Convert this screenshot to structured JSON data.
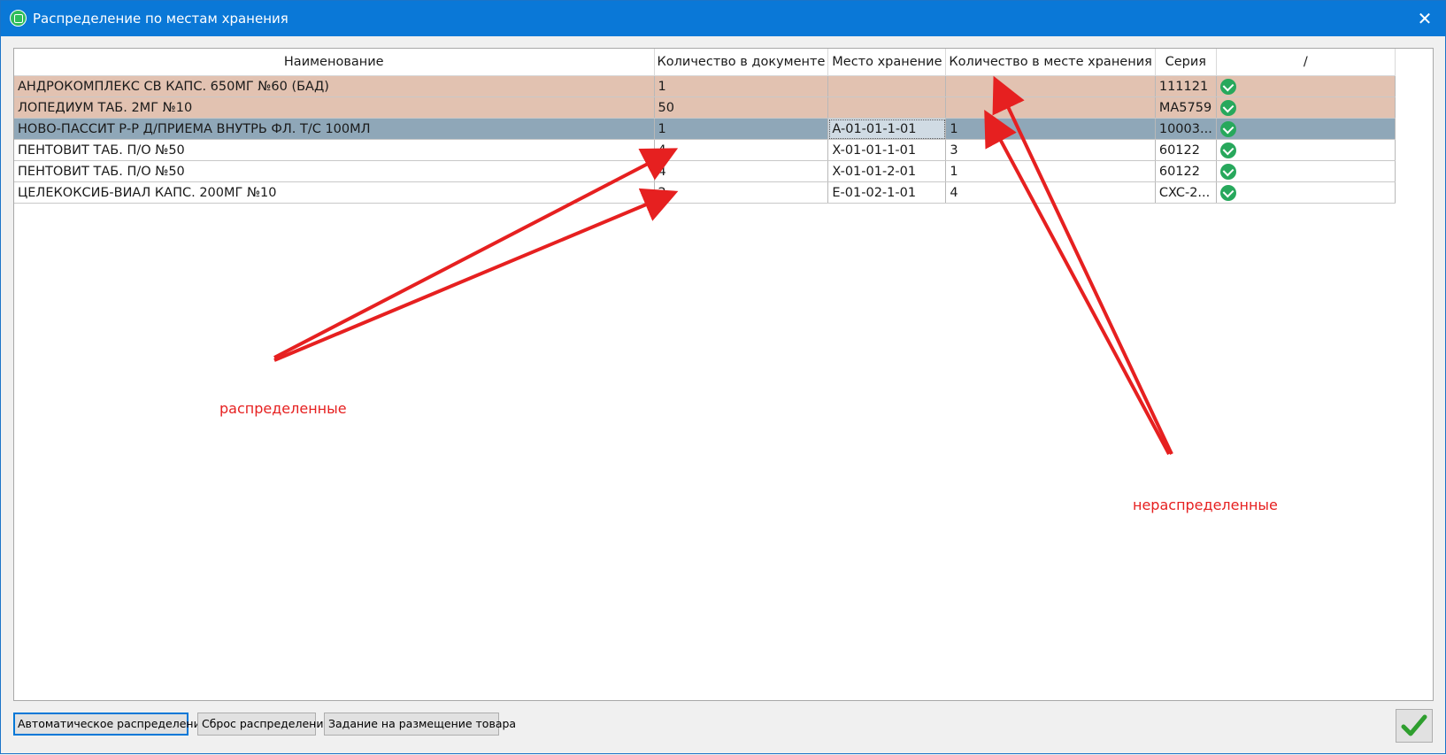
{
  "window": {
    "title": "Распределение по местам хранения",
    "close_glyph": "✕"
  },
  "grid": {
    "columns": [
      "Наименование",
      "Количество в документе",
      "Место хранение",
      "Количество в месте хранения",
      "Серия",
      "/"
    ],
    "rows": [
      {
        "name": "АНДРОКОМПЛЕКС СВ КАПС. 650МГ №60 (БАД)",
        "doc_qty": "1",
        "location": "",
        "loc_qty": "",
        "series": "111121",
        "state": "unassigned"
      },
      {
        "name": "ЛОПЕДИУМ ТАБ. 2МГ №10",
        "doc_qty": "50",
        "location": "",
        "loc_qty": "",
        "series": "MA5759",
        "state": "unassigned"
      },
      {
        "name": "НОВО-ПАССИТ Р-Р Д/ПРИЕМА ВНУТРЬ ФЛ. Т/С 100МЛ",
        "doc_qty": "1",
        "location": "A-01-01-1-01",
        "loc_qty": "1",
        "series": "10003...",
        "state": "selected"
      },
      {
        "name": "ПЕНТОВИТ ТАБ. П/О №50",
        "doc_qty": "4",
        "location": "X-01-01-1-01",
        "loc_qty": "3",
        "series": "60122",
        "state": "normal"
      },
      {
        "name": "ПЕНТОВИТ ТАБ. П/О №50",
        "doc_qty": "4",
        "location": "X-01-01-2-01",
        "loc_qty": "1",
        "series": "60122",
        "state": "normal"
      },
      {
        "name": "ЦЕЛЕКОКСИБ-ВИАЛ КАПС. 200МГ №10",
        "doc_qty": "2",
        "location": "E-01-02-1-01",
        "loc_qty": "4",
        "series": "CXC-2...",
        "state": "normal"
      }
    ],
    "row_icon": "check-circle-icon"
  },
  "annotations": {
    "distributed": "распределенные",
    "undistributed": "нераспределенные",
    "color": "#e62020"
  },
  "buttons": {
    "auto_distribute": "Автоматическое распределение",
    "reset_distribution": "Сброс распределения",
    "placement_task": "Задание на размещение товара"
  },
  "colors": {
    "titlebar": "#0a78d7",
    "unassigned_row": "#e2c2b1",
    "selected_row": "#8fa7b8",
    "ok_green": "#27a85c"
  }
}
